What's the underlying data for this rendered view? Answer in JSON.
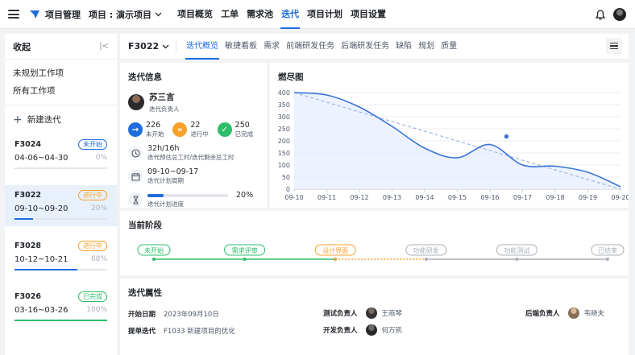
{
  "topbar": {
    "app_title": "项目管理",
    "project_label": "项目 : 演示项目",
    "nav": [
      "项目概览",
      "工单",
      "需求池",
      "迭代",
      "项目计划",
      "项目设置"
    ],
    "active_nav": "迭代"
  },
  "sidebar": {
    "title": "收起",
    "links": [
      "未规划工作项",
      "所有工作项"
    ],
    "new_iteration": "新建迭代",
    "iterations": [
      {
        "name": "F3024",
        "status": "未开始",
        "status_color": "#1e6ce0",
        "dates": "04-06~04-30",
        "pct_label": "0%",
        "progress": 0,
        "bar_color": "#c9cdd4",
        "selected": false
      },
      {
        "name": "F3022",
        "status": "进行中",
        "status_color": "#f7a02c",
        "dates": "09-10~09-20",
        "pct_label": "20%",
        "progress": 0.2,
        "bar_color": "#1e6ce0",
        "selected": true
      },
      {
        "name": "F3028",
        "status": "进行中",
        "status_color": "#f7a02c",
        "dates": "10-12~10-21",
        "pct_label": "68%",
        "progress": 0.68,
        "bar_color": "#1e6ce0",
        "selected": false
      },
      {
        "name": "F3026",
        "status": "已完成",
        "status_color": "#2ebd6b",
        "dates": "03-16~03-26",
        "pct_label": "100%",
        "progress": 1.0,
        "bar_color": "#2ebd6b",
        "selected": false
      }
    ]
  },
  "main": {
    "iteration": "F3022",
    "tabs": [
      "迭代概览",
      "敏捷看板",
      "需求",
      "前端研发任务",
      "后端研发任务",
      "缺陷",
      "规划",
      "质量"
    ],
    "active_tab": "迭代概览"
  },
  "info": {
    "title": "迭代信息",
    "owner_name": "苏三言",
    "owner_role": "迭代负责人",
    "stats": [
      {
        "value": "226",
        "label": "未开始",
        "color": "#1e6ce0",
        "icon": "→"
      },
      {
        "value": "22",
        "label": "进行中",
        "color": "#f7a02c",
        "icon": "»"
      },
      {
        "value": "250",
        "label": "已完成",
        "color": "#2ebd6b",
        "icon": "✓"
      }
    ],
    "hours_value": "32h/16h",
    "hours_label": "迭代预估总工时/迭代剩余总工时",
    "period_value": "09-10~09-17",
    "period_label": "迭代计划周期",
    "progress_label": "迭代计划进度",
    "progress_pct": "20%",
    "progress": 0.2
  },
  "burn": {
    "title": "燃尽图"
  },
  "chart_data": {
    "type": "line",
    "title": "燃尽图",
    "x": [
      "09-10",
      "09-11",
      "09-12",
      "09-13",
      "09-14",
      "09-15",
      "09-16",
      "09-17",
      "09-18",
      "09-19",
      "09-20"
    ],
    "series": [
      {
        "values": [
          400,
          390,
          340,
          260,
          170,
          130,
          185,
          100,
          95,
          70,
          10
        ],
        "color": "#3b74d6",
        "style": "solid-area"
      },
      {
        "values": [
          400,
          360,
          320,
          280,
          240,
          200,
          160,
          120,
          80,
          40,
          0
        ],
        "color": "#9fb6e3",
        "style": "dashed"
      }
    ],
    "highlight_point": {
      "x": "09-17",
      "y": 185
    },
    "ylim": [
      0,
      400
    ],
    "yticks": [
      0,
      50,
      100,
      150,
      200,
      250,
      300,
      350,
      400
    ],
    "grid": true
  },
  "stage": {
    "title": "当前阶段",
    "items": [
      {
        "label": "未开始",
        "color": "#2ebd6b"
      },
      {
        "label": "需求评审",
        "color": "#2ebd6b"
      },
      {
        "label": "设计界面",
        "color": "#f7a02c"
      },
      {
        "label": "功能研发",
        "color": "#aab0b8"
      },
      {
        "label": "功能测试",
        "color": "#aab0b8"
      },
      {
        "label": "已结束",
        "color": "#aab0b8"
      }
    ]
  },
  "attrs": {
    "title": "迭代属性",
    "start_key": "开始日期",
    "start_val": "2023年09月10日",
    "parent_key": "提单迭代",
    "parent_val": "F1033 新建项目的优化",
    "test_key": "测试负责人",
    "test_val": "王燕琴",
    "dev_key": "开发负责人",
    "dev_val": "何万凯",
    "backend_key": "后端负责人",
    "backend_val": "韦晓夫"
  }
}
